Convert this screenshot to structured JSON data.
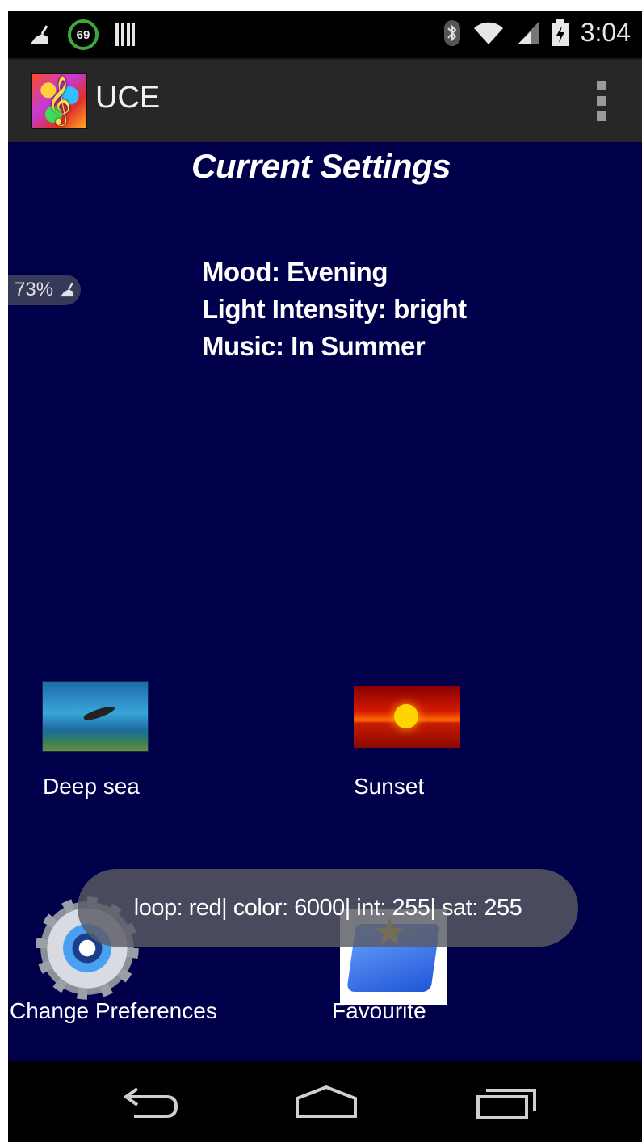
{
  "status_bar": {
    "notification_badge": "69",
    "time": "3:04"
  },
  "action_bar": {
    "title": "UCE"
  },
  "main": {
    "heading": "Current Settings",
    "settings": {
      "mood": "Mood: Evening",
      "light_intensity": "Light Intensity: bright",
      "music": "Music: In Summer"
    },
    "battery_overlay": "73%",
    "grid": [
      {
        "label": "Deep sea"
      },
      {
        "label": "Sunset"
      },
      {
        "label": "Change Preferences"
      },
      {
        "label": "Favourite"
      }
    ]
  },
  "toast": {
    "message": "loop: red| color: 6000| int: 255| sat: 255"
  },
  "colors": {
    "content_background": "#00004a",
    "action_bar": "#272727"
  }
}
